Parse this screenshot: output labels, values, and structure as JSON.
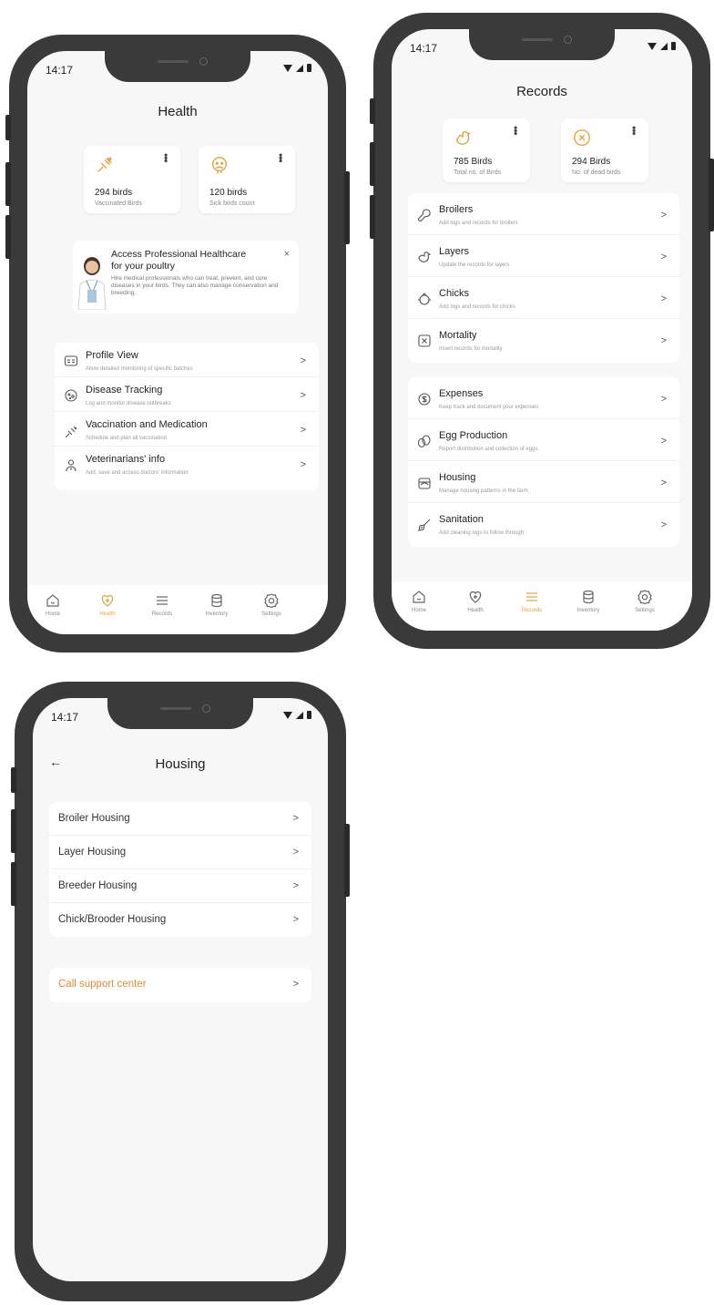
{
  "colors": {
    "accent": "#E8A23B",
    "support_text": "#E28B2C",
    "frame": "#3A3A3A",
    "screen_bg": "#F7F7F7"
  },
  "status": {
    "time": "14:17"
  },
  "health": {
    "title": "Health",
    "stats": [
      {
        "value": "294 birds",
        "label": "Vaccinated Birds",
        "icon": "syringe-bird-icon"
      },
      {
        "value": "120 birds",
        "label": "Sick birds count",
        "icon": "sick-bird-icon"
      }
    ],
    "banner": {
      "title_line1": "Access Professional Healthcare",
      "title_line2": "for your poultry",
      "description": "Hire medical professionals who can treat, prevent, and cure diseases in your birds. They can also manage conservation and breeding.",
      "close": "×"
    },
    "menu": [
      {
        "title": "Profile View",
        "subtitle": "Allow detailed monitoring of specific batches",
        "icon": "profile-card-icon"
      },
      {
        "title": "Disease Tracking",
        "subtitle": "Log and monitor disease outbreaks",
        "icon": "virus-icon"
      },
      {
        "title": "Vaccination and Medication",
        "subtitle": "Schedule and plan all vaccination",
        "icon": "syringe-icon"
      },
      {
        "title": "Veterinarians' info",
        "subtitle": "Add, save and access doctors' information",
        "icon": "doctor-icon"
      }
    ]
  },
  "records": {
    "title": "Records",
    "stats": [
      {
        "value": "785 Birds",
        "label": "Total no. of Birds",
        "icon": "bird-icon"
      },
      {
        "value": "294 Birds",
        "label": "No. of dead birds",
        "icon": "dead-bird-icon"
      }
    ],
    "group1": [
      {
        "title": "Broilers",
        "subtitle": "Add logs and records for broilers",
        "icon": "drumstick-icon"
      },
      {
        "title": "Layers",
        "subtitle": "Update the records for layers",
        "icon": "hen-icon"
      },
      {
        "title": "Chicks",
        "subtitle": "Add logs and records for chicks",
        "icon": "chick-icon"
      },
      {
        "title": "Mortality",
        "subtitle": "Insert records for mortality",
        "icon": "cross-box-icon"
      }
    ],
    "group2": [
      {
        "title": "Expenses",
        "subtitle": "Keep track and document your expenses",
        "icon": "coin-icon"
      },
      {
        "title": "Egg Production",
        "subtitle": "Report distribution and collection of eggs",
        "icon": "eggs-icon"
      },
      {
        "title": "Housing",
        "subtitle": "Manage housing patterns in the farm",
        "icon": "house-icon"
      },
      {
        "title": "Sanitation",
        "subtitle": "Add cleaning logs to follow through",
        "icon": "broom-icon"
      }
    ]
  },
  "housing": {
    "title": "Housing",
    "back": "←",
    "items": [
      {
        "title": "Broiler Housing"
      },
      {
        "title": "Layer Housing"
      },
      {
        "title": "Breeder Housing"
      },
      {
        "title": "Chick/Brooder Housing"
      }
    ],
    "support": "Call support center"
  },
  "nav": [
    {
      "label": "Home",
      "icon": "home-icon"
    },
    {
      "label": "Health",
      "icon": "health-icon"
    },
    {
      "label": "Records",
      "icon": "records-list-icon"
    },
    {
      "label": "Inventory",
      "icon": "database-icon"
    },
    {
      "label": "Settings",
      "icon": "gear-icon"
    }
  ],
  "chevron": ">"
}
